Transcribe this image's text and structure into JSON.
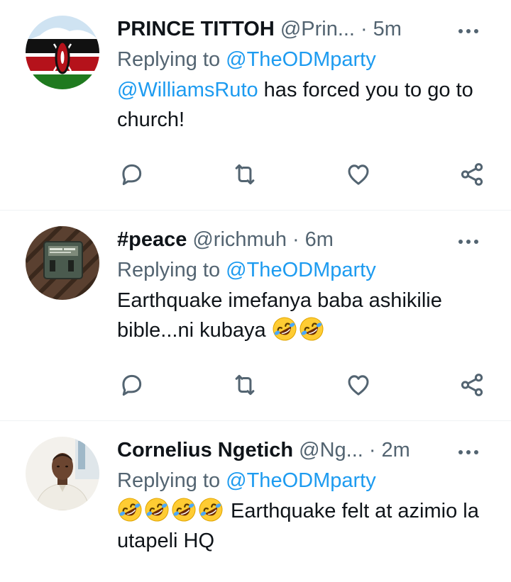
{
  "tweets": [
    {
      "name": "PRINCE TITTOH",
      "handle": "@Prin...",
      "dot": "·",
      "time": "5m",
      "replying_prefix": "Replying to",
      "replying_to": "@TheODMparty",
      "text_mention": "@WilliamsRuto",
      "text": " has forced you to go to church!",
      "avatar": "kenya-flag"
    },
    {
      "name": "#peace",
      "handle": "@richmuh",
      "dot": "·",
      "time": "6m",
      "replying_prefix": "Replying to",
      "replying_to": "@TheODMparty",
      "text": "Earthquake imefanya baba ashikilie bible...ni kubaya",
      "emoji": [
        "rolling-on-floor-laughing",
        "rolling-on-floor-laughing"
      ],
      "avatar": "device-photo"
    },
    {
      "name": "Cornelius Ngetich",
      "handle": "@Ng...",
      "dot": "·",
      "time": "2m",
      "replying_prefix": "Replying to",
      "replying_to": "@TheODMparty",
      "emoji": [
        "rolling-on-floor-laughing",
        "rolling-on-floor-laughing",
        "rolling-on-floor-laughing",
        "rolling-on-floor-laughing"
      ],
      "text": " Earthquake felt at azimio la utapeli HQ",
      "avatar": "man-photo"
    }
  ],
  "actions": [
    "reply-icon",
    "retweet-icon",
    "like-icon",
    "share-icon"
  ],
  "colors": {
    "link": "#1d9bf0",
    "secondary": "#536471",
    "primary": "#0f1419",
    "divider": "#eff3f4"
  }
}
